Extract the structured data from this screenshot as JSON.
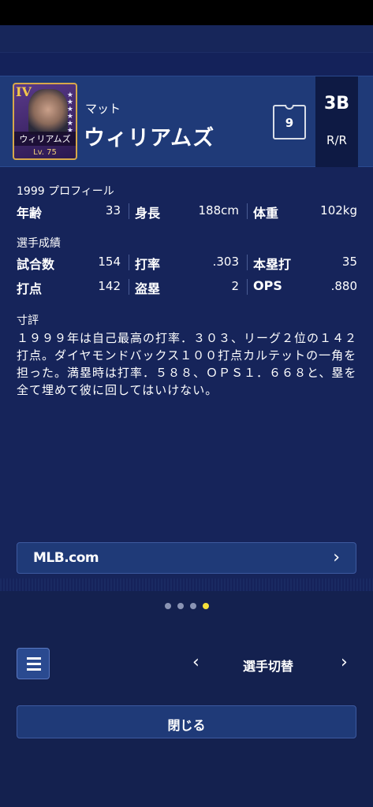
{
  "player": {
    "card_rank": "IV",
    "card_name": "ウィリアムズ",
    "card_level": "Lv. 75",
    "first_name": "マット",
    "last_name": "ウィリアムズ",
    "number": "9",
    "position": "3B",
    "bats_throws": "R/R"
  },
  "profile": {
    "title": "1999 プロフィール",
    "age_label": "年齢",
    "age": "33",
    "height_label": "身長",
    "height": "188cm",
    "weight_label": "体重",
    "weight": "102kg"
  },
  "stats": {
    "title": "選手成績",
    "games_label": "試合数",
    "games": "154",
    "avg_label": "打率",
    "avg": ".303",
    "hr_label": "本塁打",
    "hr": "35",
    "rbi_label": "打点",
    "rbi": "142",
    "sb_label": "盗塁",
    "sb": "2",
    "ops_label": "OPS",
    "ops": ".880"
  },
  "comment": {
    "title": "寸評",
    "text": "１９９９年は自己最高の打率．３０３、リーグ２位の１４２打点。ダイヤモンドバックス１００打点カルテットの一角を担った。満塁時は打率．５８８、ＯＰＳ１．６６８と、塁を全て埋めて彼に回してはいけない。"
  },
  "links": {
    "mlb_label": "MLB.com"
  },
  "pager": {
    "pages": 4,
    "active": 4
  },
  "footer": {
    "switch_label": "選手切替",
    "close_label": "閉じる",
    "prev_glyph": "‹",
    "next_glyph": "›"
  }
}
